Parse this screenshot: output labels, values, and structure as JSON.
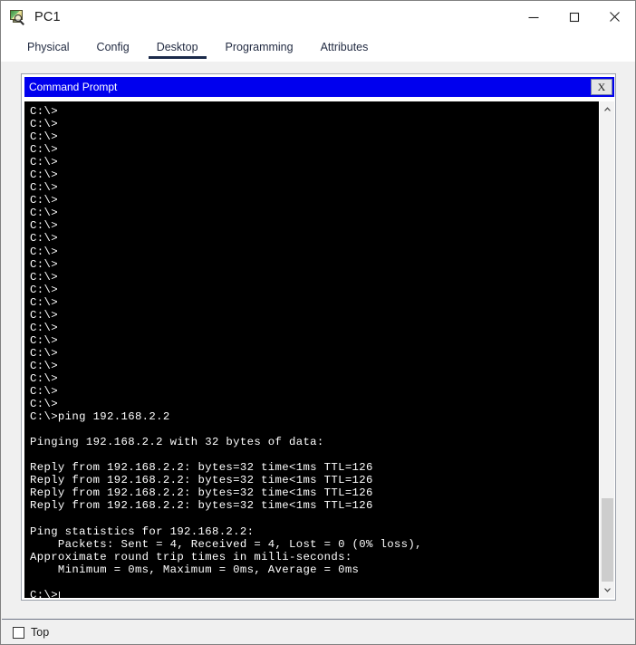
{
  "window": {
    "title": "PC1",
    "icon": "packet-tracer-pc-inspect-icon",
    "controls": {
      "minimize_label": "—",
      "maximize_label": "□",
      "close_label": "✕"
    }
  },
  "tabs": [
    {
      "label": "Physical",
      "active": false
    },
    {
      "label": "Config",
      "active": false
    },
    {
      "label": "Desktop",
      "active": true
    },
    {
      "label": "Programming",
      "active": false
    },
    {
      "label": "Attributes",
      "active": false
    }
  ],
  "command_prompt": {
    "title": "Command Prompt",
    "close_label": "X",
    "background": "#000000",
    "foreground": "#ffffff",
    "titlebar_color": "#0000ee",
    "content": "C:\\>\nC:\\>\nC:\\>\nC:\\>\nC:\\>\nC:\\>\nC:\\>\nC:\\>\nC:\\>\nC:\\>\nC:\\>\nC:\\>\nC:\\>\nC:\\>\nC:\\>\nC:\\>\nC:\\>\nC:\\>\nC:\\>\nC:\\>\nC:\\>\nC:\\>\nC:\\>\nC:\\>\nC:\\>ping 192.168.2.2\n\nPinging 192.168.2.2 with 32 bytes of data:\n\nReply from 192.168.2.2: bytes=32 time<1ms TTL=126\nReply from 192.168.2.2: bytes=32 time<1ms TTL=126\nReply from 192.168.2.2: bytes=32 time<1ms TTL=126\nReply from 192.168.2.2: bytes=32 time<1ms TTL=126\n\nPing statistics for 192.168.2.2:\n    Packets: Sent = 4, Received = 4, Lost = 0 (0% loss),\nApproximate round trip times in milli-seconds:\n    Minimum = 0ms, Maximum = 0ms, Average = 0ms\n\nC:\\>"
  },
  "scrollbar": {
    "up_arrow": "chevron-up",
    "down_arrow": "chevron-down"
  },
  "footer": {
    "top_checkbox_label": "Top",
    "top_checkbox_checked": false
  }
}
